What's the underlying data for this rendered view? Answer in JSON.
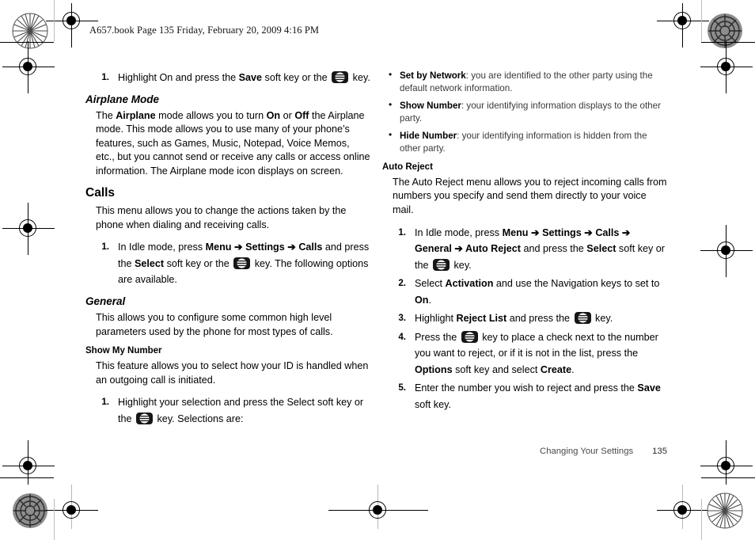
{
  "header": {
    "text": "A657.book  Page 135  Friday, February 20, 2009  4:16 PM"
  },
  "icons": {
    "phone_key": "phone-ok-key-icon",
    "bullet": "•",
    "arrow": "➔"
  },
  "left_column": {
    "step_save": {
      "number": "1.",
      "part1": "Highlight On and press the ",
      "bold1": "Save",
      "part2": " soft key or the ",
      "part3": " key."
    },
    "airplane": {
      "heading": "Airplane Mode",
      "body_part1": "The ",
      "body_bold1": "Airplane",
      "body_part2": " mode allows you to turn ",
      "body_bold2": "On",
      "body_part3": " or ",
      "body_bold3": "Off",
      "body_part4": " the Airplane mode. This mode allows you to use many of your phone’s features, such as Games, Music, Notepad, Voice Memos, etc., but you cannot send or receive any calls or access online information. The Airplane mode icon displays on screen."
    },
    "calls": {
      "heading": "Calls",
      "body": "This menu allows you to change the actions taken by the phone when dialing and receiving calls.",
      "step": {
        "number": "1.",
        "part1": "In Idle mode, press ",
        "bold_menu": "Menu",
        "arrow1": " ➔ ",
        "bold_settings": "Settings",
        "arrow2": " ➔ ",
        "bold_calls": "Calls",
        "part2": " and press the ",
        "bold_select": "Select",
        "part3": " soft key or the ",
        "part4": " key. The following options are available."
      }
    },
    "general": {
      "heading": "General",
      "body": "This allows you to configure some common high level parameters used by the phone for most types of calls."
    },
    "show_my_number": {
      "heading": "Show My Number",
      "body": "This feature allows you to select how your ID is handled when an outgoing call is initiated.",
      "step": {
        "number": "1.",
        "part1": "Highlight your selection and press the Select soft key or the ",
        "part2": " key. Selections are:"
      }
    }
  },
  "right_column": {
    "number_options": [
      {
        "label": "Set by Network",
        "text": ": you are identified to the other party using the default network information."
      },
      {
        "label": "Show Number",
        "text": ": your identifying information displays to the other party."
      },
      {
        "label": "Hide Number",
        "text": ": your identifying information is hidden from the other party."
      }
    ],
    "auto_reject": {
      "heading": "Auto Reject",
      "body": "The Auto Reject menu allows you to reject incoming calls from numbers you specify and send them directly to your voice mail.",
      "steps": [
        {
          "number": "1.",
          "part1": "In Idle mode, press ",
          "bold_menu": "Menu",
          "arrow1": " ➔ ",
          "bold_settings": "Settings",
          "arrow2": " ➔ ",
          "bold_calls": "Calls",
          "arrow3": " ➔ ",
          "bold_general": "General",
          "arrow4": " ➔ ",
          "bold_autoreject": "Auto Reject",
          "part2": " and press the ",
          "bold_select": "Select",
          "part3": " soft key or the ",
          "part4": " key."
        },
        {
          "number": "2.",
          "part1": "Select ",
          "bold1": "Activation",
          "part2": " and use the Navigation keys to set to ",
          "bold2": "On",
          "part3": "."
        },
        {
          "number": "3.",
          "part1": "Highlight ",
          "bold1": "Reject List",
          "part2": " and press the ",
          "part3": " key."
        },
        {
          "number": "4.",
          "part1": "Press the ",
          "part2": " key to place a check next to the number you want to reject, or if it is not in the list, press the ",
          "bold1": "Options",
          "part3": " soft key and select ",
          "bold2": "Create",
          "part4": "."
        },
        {
          "number": "5.",
          "part1": "Enter the number you wish to reject and press the ",
          "bold1": "Save",
          "part2": " soft key."
        }
      ]
    }
  },
  "footer": {
    "chapter": "Changing Your Settings",
    "page_number": "135"
  }
}
